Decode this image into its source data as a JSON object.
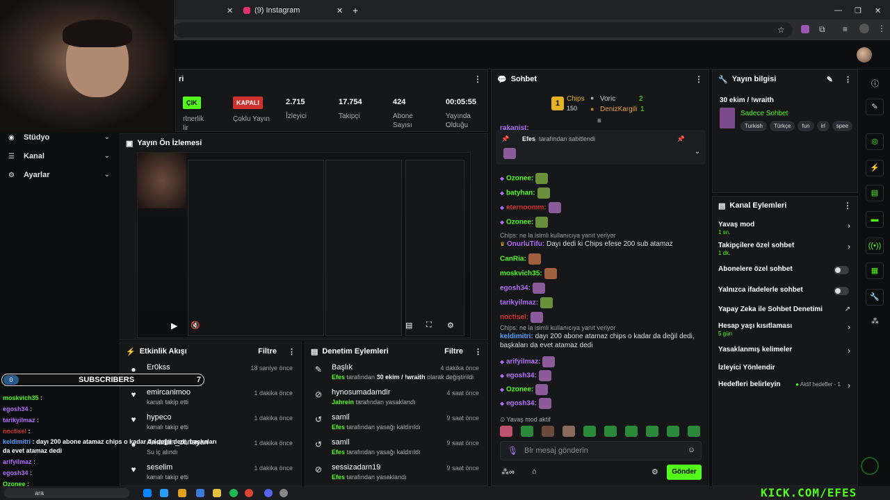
{
  "browser": {
    "tab_instagram": "(9) Instagram",
    "new_tab_icon": "plus-icon"
  },
  "left_nav": {
    "items": [
      {
        "label": "Stüdyo",
        "icon": "studio-icon"
      },
      {
        "label": "Kanal",
        "icon": "channel-icon"
      },
      {
        "label": "Ayarlar",
        "icon": "gear-icon"
      }
    ]
  },
  "stats": {
    "partner_badge": "ÇIK",
    "partner_label_1": "rtnerlik",
    "partner_label_2": "lir",
    "multi_badge": "KAPALI",
    "multi_label": "Çoklu Yayın",
    "viewers_value": "2.715",
    "viewers_label": "İzleyici",
    "followers_value": "17.754",
    "followers_label": "Takipçi",
    "subs_value": "424",
    "subs_label_1": "Abone",
    "subs_label_2": "Sayısı",
    "uptime_value": "00:05:55",
    "uptime_label_1": "Yayında",
    "uptime_label_2": "Olduğu",
    "title_fragment": "ri"
  },
  "preview": {
    "title": "Yayın Ön İzlemesi"
  },
  "activity": {
    "title": "Etkinlik Akışı",
    "filter": "Filtre",
    "events": [
      {
        "name": "Er0kss",
        "sub": "Su iç alındı",
        "time": "18 saniye önce",
        "icon": "drop-icon"
      },
      {
        "name": "emircanimoo",
        "sub": "kanalı takip etti",
        "time": "1 dakika önce",
        "icon": "heart-icon"
      },
      {
        "name": "hypeco",
        "sub": "kanalı takip etti",
        "time": "1 dakika önce",
        "icon": "heart-icon"
      },
      {
        "name": "Arkadan_zoriayan",
        "sub": "Su iç alındı",
        "time": "1 dakika önce",
        "icon": "drop-icon"
      },
      {
        "name": "seselim",
        "sub": "kanalı takip etti",
        "time": "1 dakika önce",
        "icon": "heart-icon"
      }
    ]
  },
  "moderation": {
    "title": "Denetim Eylemleri",
    "filter": "Filtre",
    "events": [
      {
        "name": "Başlık",
        "actor": "Efes",
        "rest": " tarafından ",
        "bold": "30 ekim / !wraith",
        "tail": " olarak değiştirildi",
        "time": "4 dakika önce",
        "icon": "edit-icon"
      },
      {
        "name": "hynosumadamdir",
        "actor": "Jahrein",
        "rest": " tarafından yasaklandı",
        "bold": "",
        "tail": "",
        "time": "4 saat önce",
        "icon": "ban-icon"
      },
      {
        "name": "samil",
        "actor": "Efes",
        "rest": " tarafından yasağı kaldırıldı",
        "bold": "",
        "tail": "",
        "time": "9 saat önce",
        "icon": "undo-icon"
      },
      {
        "name": "samil",
        "actor": "Efes",
        "rest": " tarafından yasağı kaldırıldı",
        "bold": "",
        "tail": "",
        "time": "9 saat önce",
        "icon": "undo-icon"
      },
      {
        "name": "sessizadam19",
        "actor": "Efes",
        "rest": " tarafından yasaklandı",
        "bold": "",
        "tail": "",
        "time": "9 saat önce",
        "icon": "ban-icon"
      }
    ]
  },
  "chat": {
    "title": "Sohbet",
    "leader_chips": "Chips",
    "leader_chips_count": "150",
    "leader_rank": "1",
    "leader_voric": "Voric",
    "leader_voric_count": "2",
    "leader_deniz": "DenizKargili",
    "leader_deniz_count": "1",
    "pinned_by_name": "Efes",
    "pinned_by_text": " tarafından sabitlendi",
    "top_partial": "rakanist:",
    "lines": [
      {
        "user": "Ozonee:",
        "color": "#53fc18",
        "text": "",
        "emote": "#6a8f3a"
      },
      {
        "user": "batyhan:",
        "color": "#53fc18",
        "text": "",
        "emote": "#6a8f3a"
      },
      {
        "user": "eternoomm:",
        "color": "#d0302b",
        "text": "",
        "emote": "#8a5a9a"
      },
      {
        "user": "Ozonee:",
        "color": "#53fc18",
        "text": "",
        "emote": "#6a8f3a"
      }
    ],
    "reply1": "Chips: ne la isimli kullanıcıya yanıt veriyor",
    "onur_user": "OnurluTifu:",
    "onur_text": " Dayı dedi ki Chips efese 200 sub atamaz",
    "lines2": [
      {
        "user": "CanRia:",
        "color": "#53fc18",
        "emote": "#a06040"
      },
      {
        "user": "moskvich35:",
        "color": "#53fc18",
        "emote": "#a06040"
      },
      {
        "user": "egosh34:",
        "color": "#b06cf5",
        "emote": "#8a5a9a"
      },
      {
        "user": "tarikyilmaz:",
        "color": "#b06cf5",
        "emote": "#6a8f3a"
      },
      {
        "user": "noctisel:",
        "color": "#d0302b",
        "emote": "#8a5a9a"
      }
    ],
    "reply2": "Chips: ne la isimli kullanıcıya yanıt veriyor",
    "keld_user": "keldimitri:",
    "keld_text": " dayı 200 abone atamaz chips o kadar da değil dedi, başkaları da evet atamaz dedi",
    "lines3": [
      {
        "user": "arifyilmaz:",
        "color": "#b06cf5",
        "emote": "#8a5a9a"
      },
      {
        "user": "egosh34:",
        "color": "#b06cf5",
        "emote": "#8a5a9a"
      },
      {
        "user": "Ozonee:",
        "color": "#53fc18",
        "emote": "#8a5a9a"
      },
      {
        "user": "egosh34:",
        "color": "#b06cf5",
        "emote": "#8a5a9a"
      }
    ],
    "slow_mode": "Yavaş mod aktif",
    "input_placeholder": "Bir mesaj gönderin",
    "send": "Gönder"
  },
  "stream_info": {
    "title": "Yayın bilgisi",
    "stream_title": "30 ekim / !wraith",
    "category": "Sadece Sohbet",
    "tags": [
      "Turkish",
      "Türkçe",
      "fun",
      "irl",
      "spee"
    ]
  },
  "channel_actions": {
    "title": "Kanal Eylemleri",
    "rows": [
      {
        "label": "Yavaş mod",
        "sub": "1 sn.",
        "kind": "chevron"
      },
      {
        "label": "Takipçilere özel sohbet",
        "sub": "1 dk.",
        "kind": "chevron"
      },
      {
        "label": "Abonelere özel sohbet",
        "sub": "",
        "kind": "toggle"
      },
      {
        "label": "Yalnızca ifadelerle sohbet",
        "sub": "",
        "kind": "toggle"
      },
      {
        "label": "Yapay Zeka ile Sohbet Denetimi",
        "sub": "",
        "kind": "external"
      },
      {
        "label": "Hesap yaşı kısıtlaması",
        "sub": "5 gün",
        "kind": "chevron"
      },
      {
        "label": "Yasaklanmış kelimeler",
        "sub": "",
        "kind": "chevron"
      },
      {
        "label": "İzleyici Yönlendir",
        "sub": "",
        "kind": "none"
      },
      {
        "label": "Hedefleri belirleyin",
        "sub": "",
        "kind": "goal"
      }
    ],
    "goal_status": "Aktif hedefler - 1"
  },
  "overlay": {
    "subs_count_left": "0",
    "subs_label": "SUBSCRIBERS",
    "subs_count_right": "7",
    "chat": [
      {
        "user": "moskvich35",
        "color": "#53fc18",
        "text": " :"
      },
      {
        "user": "egosh34",
        "color": "#b06cf5",
        "text": " :"
      },
      {
        "user": "tarikyilmaz",
        "color": "#b06cf5",
        "text": " :"
      },
      {
        "user": "noctisel",
        "color": "#d0302b",
        "text": " :"
      },
      {
        "user": "keldimitri",
        "color": "#5aa0ff",
        "text": " : dayı 200 abone atamaz chips o kadar da değil dedi, başkaları"
      },
      {
        "user": "",
        "color": "#ffffff",
        "text": "da evet atamaz dedi"
      },
      {
        "user": "arifyilmaz",
        "color": "#b06cf5",
        "text": " :"
      },
      {
        "user": "egosh34",
        "color": "#b06cf5",
        "text": " :"
      },
      {
        "user": "Ozonee",
        "color": "#53fc18",
        "text": " :"
      }
    ],
    "watermark": "KICK.COM/EFES"
  },
  "taskbar": {
    "search_fragment": "ara"
  }
}
